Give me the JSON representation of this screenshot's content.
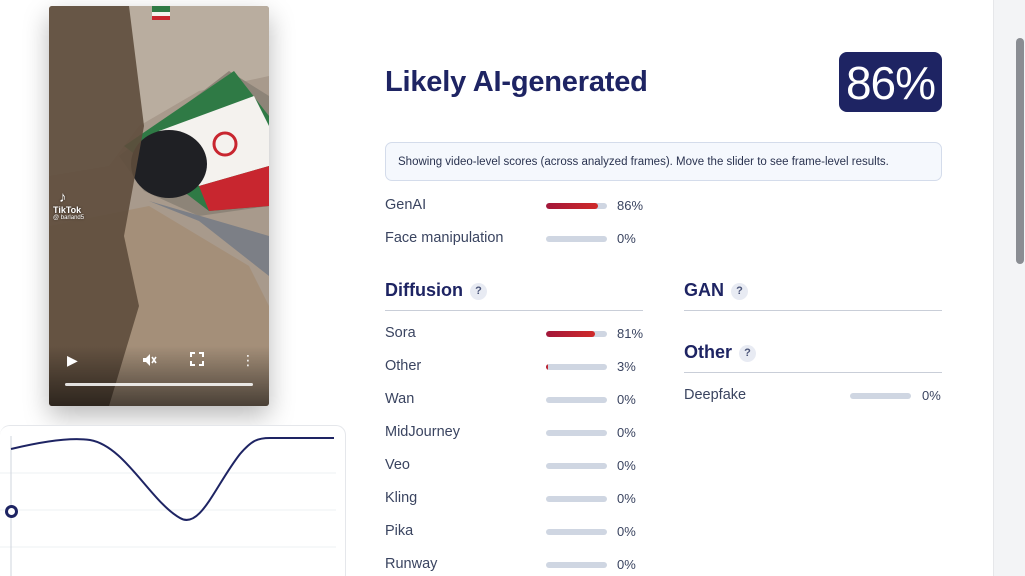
{
  "video": {
    "watermark_brand": "TikTok",
    "watermark_handle": "@ barland5",
    "controls": {
      "play": "▶",
      "mute": "🔇",
      "fullscreen": "⛶",
      "more": "⋮"
    },
    "progress": 1.0
  },
  "result": {
    "verdict": "Likely AI-generated",
    "score": "86%",
    "notice": "Showing video-level scores (across analyzed frames). Move the slider to see frame-level results."
  },
  "summary": [
    {
      "label": "GenAI",
      "value": 86,
      "pct": "86%"
    },
    {
      "label": "Face manipulation",
      "value": 0,
      "pct": "0%"
    }
  ],
  "diffusion": {
    "title": "Diffusion",
    "help": "?",
    "items": [
      {
        "label": "Sora",
        "value": 81,
        "pct": "81%"
      },
      {
        "label": "Other",
        "value": 3,
        "pct": "3%"
      },
      {
        "label": "Wan",
        "value": 0,
        "pct": "0%"
      },
      {
        "label": "MidJourney",
        "value": 0,
        "pct": "0%"
      },
      {
        "label": "Veo",
        "value": 0,
        "pct": "0%"
      },
      {
        "label": "Kling",
        "value": 0,
        "pct": "0%"
      },
      {
        "label": "Pika",
        "value": 0,
        "pct": "0%"
      },
      {
        "label": "Runway",
        "value": 0,
        "pct": "0%"
      }
    ]
  },
  "gan": {
    "title": "GAN",
    "help": "?"
  },
  "other": {
    "title": "Other",
    "help": "?",
    "items": [
      {
        "label": "Deepfake",
        "value": 0,
        "pct": "0%"
      }
    ]
  },
  "colors": {
    "accent": "#1e2463",
    "bar_fill": "#c0222e",
    "bar_track": "#cfd6e2"
  },
  "icons": [
    "play-icon",
    "mute-icon",
    "fullscreen-icon",
    "more-icon",
    "help-icon",
    "tiktok-logo-icon"
  ]
}
